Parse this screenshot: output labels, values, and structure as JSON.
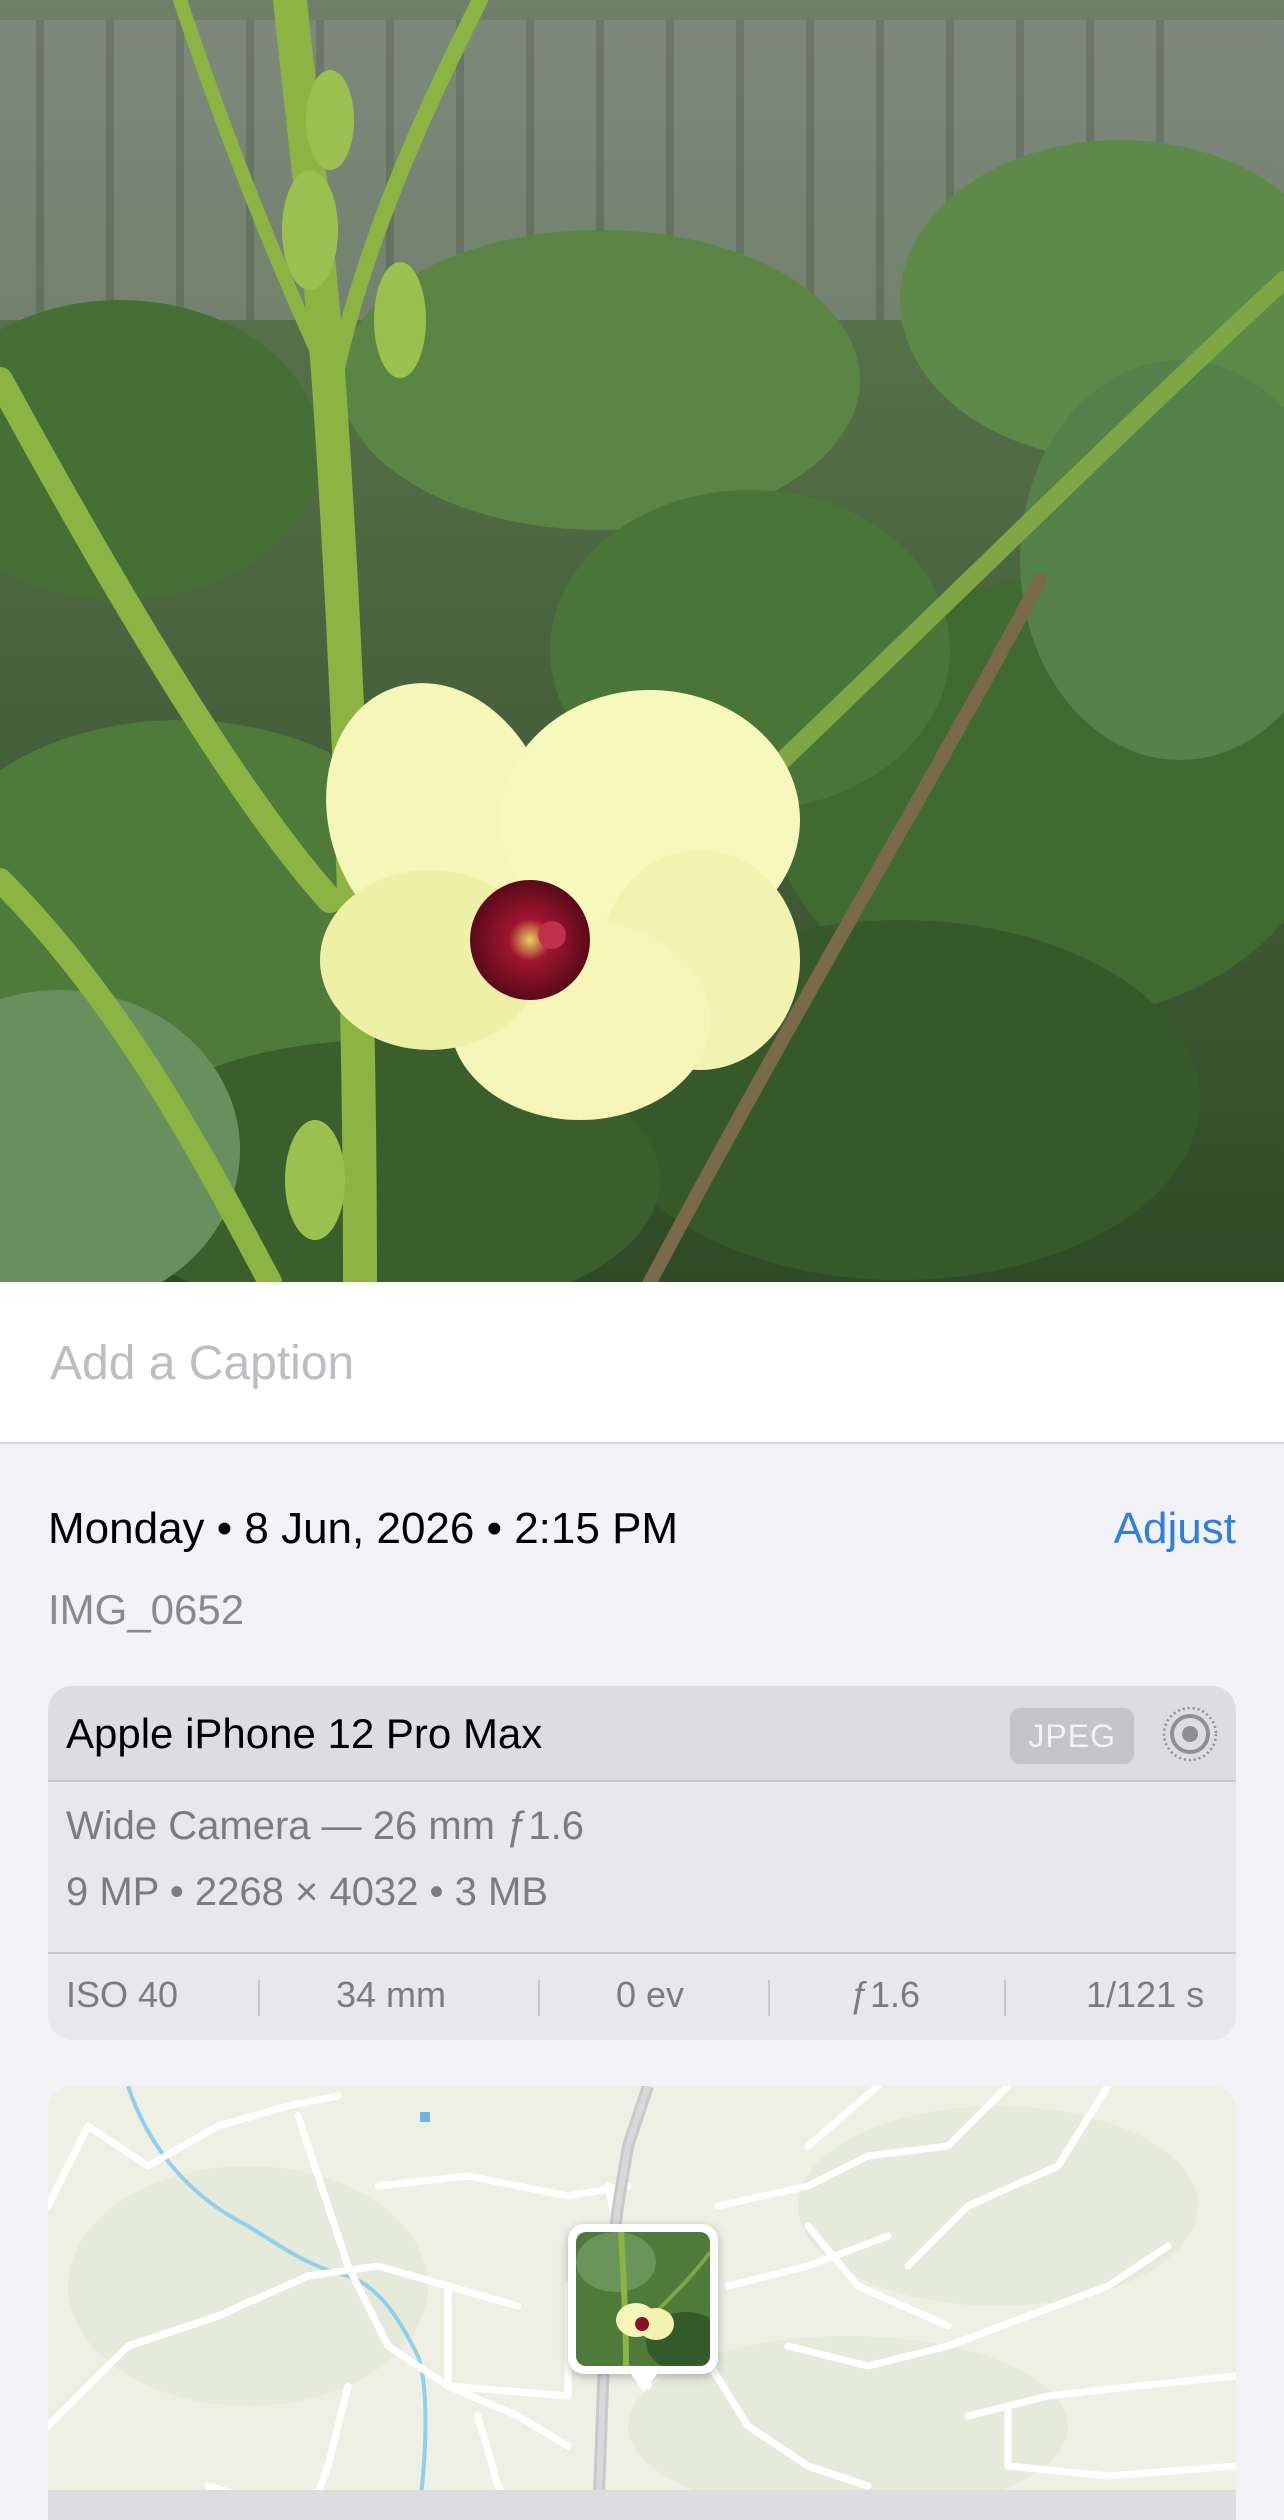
{
  "photo": {
    "subject": "yellow okra flower"
  },
  "caption": {
    "placeholder": "Add a Caption"
  },
  "info": {
    "datetime": "Monday • 8 Jun, 2026 • 2:15 PM",
    "adjust_label": "Adjust",
    "filename": "IMG_0652"
  },
  "camera": {
    "device": "Apple iPhone 12 Pro Max",
    "format_badge": "JPEG",
    "live_icon": "live-photo-icon",
    "lens": "Wide Camera — 26 mm ƒ1.6",
    "specs": "9 MP • 2268 × 4032 • 3 MB",
    "exif": {
      "iso": "ISO 40",
      "focal": "34 mm",
      "ev": "0 ev",
      "aperture": "ƒ1.6",
      "shutter": "1/121 s"
    }
  },
  "map": {
    "icon": "map-photo-pin"
  },
  "colors": {
    "accent": "#2f7fe0",
    "background": "#f2f2f7"
  }
}
